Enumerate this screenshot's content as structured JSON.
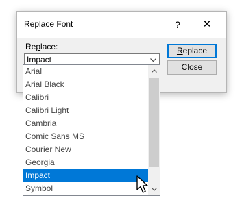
{
  "dialog": {
    "title": "Replace Font",
    "help_icon": "?",
    "close_icon": "✕",
    "replace_label_prefix": "Re",
    "replace_label_accel": "p",
    "replace_label_suffix": "lace:",
    "replace_value": "Impact",
    "replace_button_accel": "R",
    "replace_button_rest": "eplace",
    "close_button_accel": "C",
    "close_button_rest": "lose"
  },
  "dropdown": {
    "items": [
      "Arial",
      "Arial Black",
      "Calibri",
      "Calibri Light",
      "Cambria",
      "Comic Sans MS",
      "Courier New",
      "Georgia",
      "Impact",
      "Symbol"
    ],
    "selected": "Impact"
  },
  "colors": {
    "selection": "#0078d7",
    "dialog_bg": "#f0f0f0"
  },
  "icons": {
    "dropdown_arrow": "chevron-down-icon",
    "scroll_up": "scroll-up-arrow-icon",
    "scroll_down": "scroll-down-arrow-icon",
    "cursor": "mouse-pointer-icon"
  }
}
